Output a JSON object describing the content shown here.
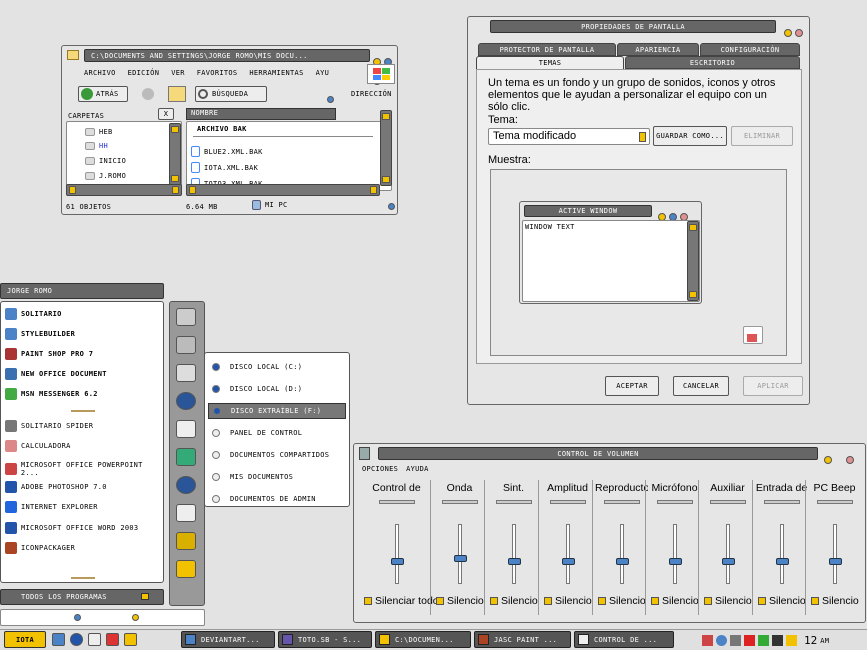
{
  "explorer": {
    "title": "C:\\Documents and Settings\\Jorge Romo\\Mis docu...",
    "menu": [
      "Archivo",
      "Edición",
      "Ver",
      "Favoritos",
      "Herramientas",
      "Ayu"
    ],
    "back": "Atrás",
    "search": "Búsqueda",
    "address": "Dirección",
    "folders_label": "Carpetas",
    "close_x": "X",
    "tree": [
      "HEB",
      "HH",
      "inicio",
      "J.Romo"
    ],
    "col_name": "Nombre",
    "group": "Archivo BAK",
    "files": [
      "blue2.xml.bak",
      "iota.xml.bak",
      "toto3.xml.bak"
    ],
    "status_objects": "61 objetos",
    "status_size": "6.64 MB",
    "status_pc": "Mi PC"
  },
  "props": {
    "title": "Propiedades de pantalla",
    "tabs_top": [
      "Protector de pantalla",
      "Apariencia",
      "Configuración"
    ],
    "tabs_bottom": [
      "Temas",
      "Escritorio"
    ],
    "desc": "Un tema es un fondo y un grupo de sonidos, iconos y otros elementos que le ayudan a personalizar el equipo con un sólo clic.",
    "theme_label": "Tema:",
    "theme_value": "Tema modificado",
    "save": "Guardar como...",
    "delete": "Eliminar",
    "sample_label": "Muestra:",
    "active_window": "Active Window",
    "window_text": "Window Text",
    "ok": "Aceptar",
    "cancel": "Cancelar",
    "apply": "Aplicar"
  },
  "start": {
    "user": "Jorge Romo",
    "pinned": [
      "Solitario",
      "StyleBuilder",
      "Paint Shop Pro 7",
      "New Office Document",
      "MSN Messenger 6.2"
    ],
    "recent": [
      "Solitario Spider",
      "Calculadora",
      "Microsoft Office PowerPoint 2...",
      "Adobe Photoshop 7.0",
      "Internet Explorer",
      "Microsoft Office Word 2003",
      "IconPackager"
    ],
    "all": "Todos los programas"
  },
  "submenu": [
    "Disco local (C:)",
    "Disco local (D:)",
    "Disco extraíble (F:)",
    "Panel de control",
    "Documentos compartidos",
    "Mis documentos",
    "Documentos de Admin"
  ],
  "volume": {
    "title": "Control de volumen",
    "menu": [
      "Opciones",
      "Ayuda"
    ],
    "channels": [
      {
        "name": "Control de",
        "mute": "Silenciar todo",
        "level": 0.4
      },
      {
        "name": "Onda",
        "mute": "Silencio",
        "level": 0.45
      },
      {
        "name": "Sint.",
        "mute": "Silencio",
        "level": 0.4
      },
      {
        "name": "Amplitud",
        "mute": "Silencio",
        "level": 0.4
      },
      {
        "name": "Reproductor",
        "mute": "Silencio",
        "level": 0.4
      },
      {
        "name": "Micrófono",
        "mute": "Silencio",
        "level": 0.4
      },
      {
        "name": "Auxiliar",
        "mute": "Silencio",
        "level": 0.4
      },
      {
        "name": "Entrada de",
        "mute": "Silencio",
        "level": 0.4
      },
      {
        "name": "PC Beep",
        "mute": "Silencio",
        "level": 0.4
      }
    ]
  },
  "taskbar": {
    "start": "IOTA",
    "tasks": [
      "deviantART...",
      "toto.sb - S...",
      "C:\\Documen...",
      "Jasc Paint ...",
      "Control de ..."
    ],
    "clock": "12",
    "ampm": "AM"
  },
  "colors": {
    "accent": "#f2c200",
    "blue": "#4c82c6",
    "bar": "#666666"
  }
}
